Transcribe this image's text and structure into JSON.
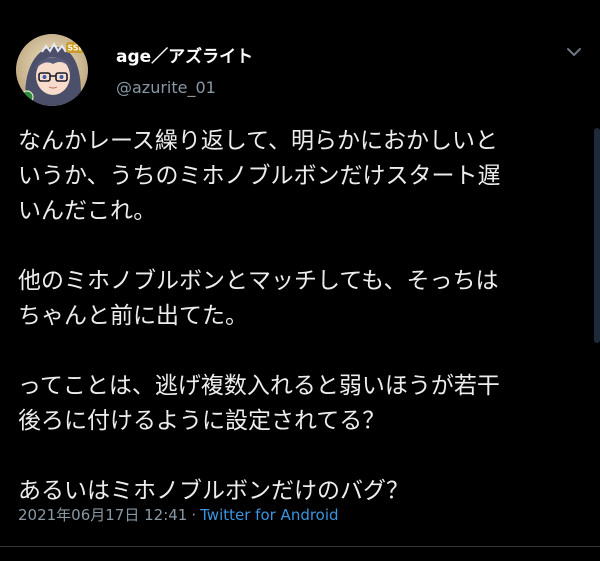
{
  "user": {
    "display_name": "age／アズライト",
    "handle": "@azurite_01",
    "avatar_badge": "SSR"
  },
  "tweet": {
    "paragraphs": [
      "なんかレース繰り返して、明らかにおかしいと\nいうか、うちのミホノブルボンだけスタート遅\nいんだこれ。",
      "他のミホノブルボンとマッチしても、そっちは\nちゃんと前に出てた。",
      "ってことは、逃げ複数入れると弱いほうが若干\n後ろに付けるように設定されてる？",
      "あるいはミホノブルボンだけのバグ？"
    ],
    "timestamp": "2021年06月17日 12:41",
    "separator": "·",
    "source": "Twitter for Android"
  },
  "icons": {
    "caret": "chevron-down-icon",
    "avatar": "avatar-image"
  },
  "colors": {
    "background": "#000000",
    "text": "#ededed",
    "secondary": "#8899a6",
    "link": "#3b94e0"
  }
}
